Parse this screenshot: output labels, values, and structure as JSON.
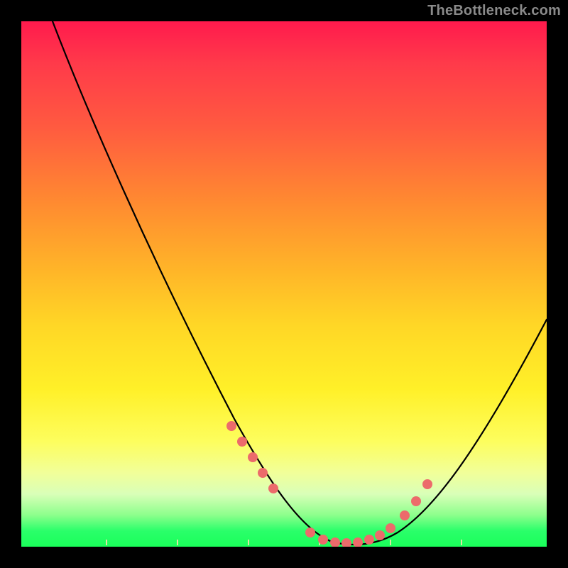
{
  "watermark": "TheBottleneck.com",
  "chart_data": {
    "type": "line",
    "title": "",
    "xlabel": "",
    "ylabel": "",
    "xlim": [
      0,
      100
    ],
    "ylim": [
      0,
      100
    ],
    "grid": false,
    "series": [
      {
        "name": "curve",
        "x": [
          6,
          10,
          15,
          20,
          25,
          30,
          35,
          40,
          45,
          50,
          53,
          56,
          59,
          62,
          65,
          70,
          75,
          80,
          85,
          90,
          95,
          100
        ],
        "y": [
          100,
          92,
          83,
          74,
          65,
          55,
          45,
          36,
          26,
          16,
          10,
          5,
          2,
          0,
          0,
          1,
          6,
          14,
          24,
          35,
          46,
          55
        ]
      }
    ],
    "markers": {
      "name": "highlight-dots",
      "color": "#ec6b6b",
      "x": [
        40,
        42,
        44,
        46,
        48,
        55,
        58,
        60,
        62,
        64,
        66,
        68,
        70,
        72,
        74,
        76
      ],
      "y": [
        23,
        20,
        17,
        14,
        11,
        2,
        1,
        0,
        0,
        0,
        0,
        1,
        3,
        6,
        10,
        15
      ]
    },
    "background_gradient": {
      "direction": "top-to-bottom",
      "stops": [
        {
          "pos": 0.0,
          "color": "#ff1a4d"
        },
        {
          "pos": 0.35,
          "color": "#ff8c30"
        },
        {
          "pos": 0.7,
          "color": "#fff028"
        },
        {
          "pos": 0.88,
          "color": "#f1ff9a"
        },
        {
          "pos": 1.0,
          "color": "#1aff5a"
        }
      ]
    }
  }
}
